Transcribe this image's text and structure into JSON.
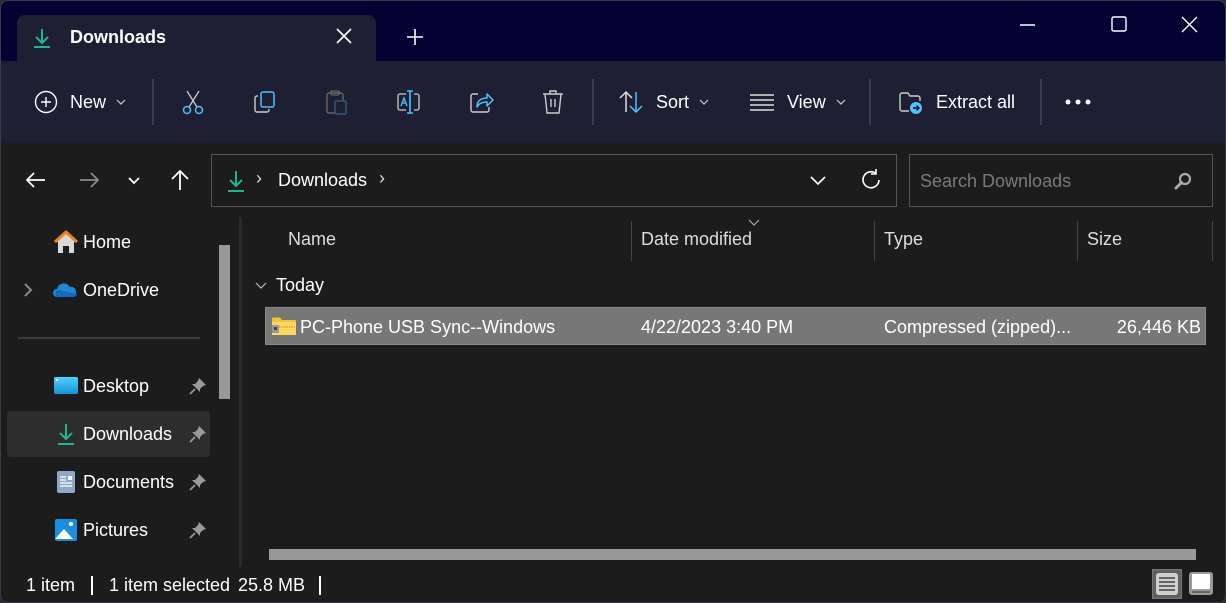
{
  "titlebar": {
    "tab_title": "Downloads",
    "tab_icon": "download-icon",
    "new_tab_icon": "plus-icon",
    "window_controls": [
      "minimize",
      "maximize",
      "close"
    ]
  },
  "command_bar": {
    "new_label": "New",
    "cut_icon": "scissors-icon",
    "copy_icon": "copy-icon",
    "paste_icon": "paste-icon",
    "rename_icon": "rename-icon",
    "share_icon": "share-icon",
    "delete_icon": "trash-icon",
    "sort_label": "Sort",
    "view_label": "View",
    "extract_label": "Extract all",
    "more_icon": "ellipsis-icon"
  },
  "address_bar": {
    "location_icon": "download-icon",
    "path": [
      "Downloads"
    ],
    "search_placeholder": "Search Downloads"
  },
  "sidebar": {
    "items": [
      {
        "label": "Home",
        "icon": "home-icon",
        "pinned": false,
        "expandable": false
      },
      {
        "label": "OneDrive",
        "icon": "onedrive-cloud-icon",
        "pinned": false,
        "expandable": true
      },
      {
        "label": "Desktop",
        "icon": "desktop-icon",
        "pinned": true
      },
      {
        "label": "Downloads",
        "icon": "download-icon",
        "pinned": true,
        "selected": true
      },
      {
        "label": "Documents",
        "icon": "documents-icon",
        "pinned": true
      },
      {
        "label": "Pictures",
        "icon": "pictures-icon",
        "pinned": true
      }
    ]
  },
  "file_list": {
    "columns": [
      "Name",
      "Date modified",
      "Type",
      "Size"
    ],
    "sorted_by": "Date modified",
    "groups": [
      {
        "label": "Today",
        "rows": [
          {
            "name": "PC-Phone USB Sync--Windows",
            "date_modified": "4/22/2023 3:40 PM",
            "type": "Compressed (zipped)...",
            "size": "26,446 KB",
            "icon": "zip-folder-icon",
            "selected": true
          }
        ]
      }
    ]
  },
  "status_bar": {
    "item_count": "1 item",
    "selection": "1 item selected",
    "selection_size": "25.8 MB",
    "view_mode": "details"
  },
  "colors": {
    "title_bg": "#030333",
    "command_bg": "#1e1f33",
    "content_bg": "#1c1c1c",
    "accent_teal": "#1fb58f",
    "accent_blue": "#4cc2ff",
    "selected_row": "#777777"
  }
}
